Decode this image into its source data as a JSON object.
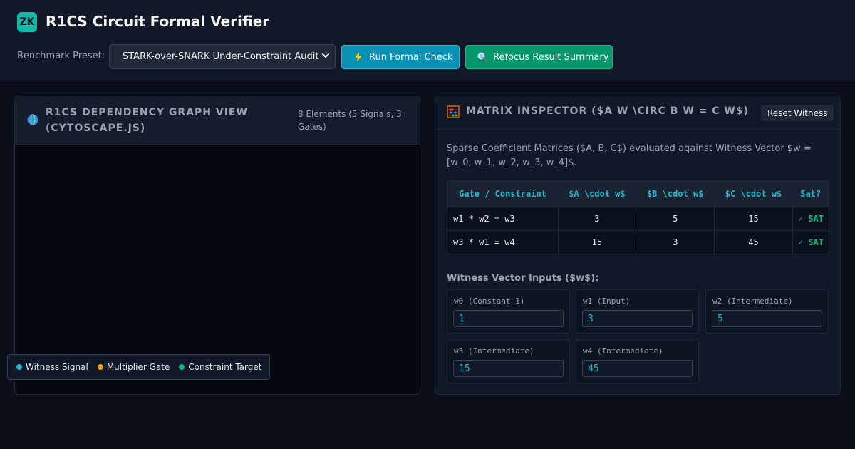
{
  "app": {
    "logo_text": "ZK",
    "title": "R1CS Circuit Formal Verifier"
  },
  "toolbar": {
    "preset_label": "Benchmark Preset:",
    "preset_value": "STARK-over-SNARK Under-Constraint Audit",
    "run_label": "Run Formal Check",
    "run_icon": "lightning-icon",
    "refocus_label": "Refocus Result Summary",
    "refocus_icon": "search-icon"
  },
  "graph_panel": {
    "icon": "globe-icon",
    "title": "R1CS Dependency Graph View (Cytoscape.js)",
    "element_count": "8 Elements (5 Signals, 3 Gates)"
  },
  "legend": {
    "items": [
      {
        "label": "Witness Signal",
        "color": "#22b8cf"
      },
      {
        "label": "Multiplier Gate",
        "color": "#f59e0b"
      },
      {
        "label": "Constraint Target",
        "color": "#10b981"
      }
    ]
  },
  "matrix_panel": {
    "icon": "abacus-icon",
    "title": "Matrix Inspector ($A w \\circ B w = C w$)",
    "reset_label": "Reset Witness",
    "description": "Sparse Coefficient Matrices ($A, B, C$) evaluated against Witness Vector $w = [w_0, w_1, w_2, w_3, w_4]$.",
    "table": {
      "headers": [
        "Gate / Constraint",
        "$A \\cdot w$",
        "$B \\cdot w$",
        "$C \\cdot w$",
        "Sat?"
      ],
      "rows": [
        {
          "gate": "w1 * w2 = w3",
          "a": "3",
          "b": "5",
          "c": "15",
          "sat": "✓ SAT"
        },
        {
          "gate": "w3 * w1 = w4",
          "a": "15",
          "b": "3",
          "c": "45",
          "sat": "✓ SAT"
        }
      ]
    },
    "witness_label": "Witness Vector Inputs ($w$):",
    "witness": [
      {
        "name": "w0 (Constant 1)",
        "value": "1"
      },
      {
        "name": "w1 (Input)",
        "value": "3"
      },
      {
        "name": "w2 (Intermediate)",
        "value": "5"
      },
      {
        "name": "w3 (Intermediate)",
        "value": "15"
      },
      {
        "name": "w4 (Intermediate)",
        "value": "45"
      }
    ]
  },
  "colors": {
    "accent_cyan": "#22b8cf",
    "accent_green": "#10b981",
    "accent_amber": "#f59e0b",
    "run_button": "#0891b2",
    "refocus_button": "#059669"
  }
}
